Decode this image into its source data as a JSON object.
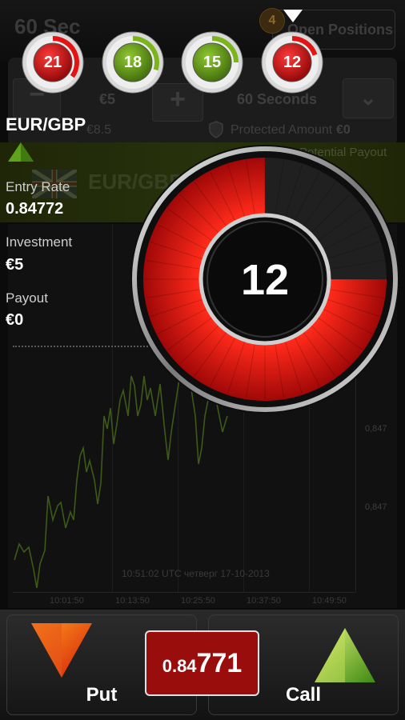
{
  "header": {
    "title": "60 Sec",
    "open_positions_label": "Open Positions",
    "open_positions_count": "4"
  },
  "trade_panel": {
    "investment_value": "€5",
    "expiry_value": "60 Seconds",
    "payout_value": "€8.5",
    "protected_amount_label": "Protected Amount",
    "protected_amount_value": "€0",
    "potential_payout_label": "Potential Payout"
  },
  "asset_bar": {
    "asset_name": "EUR/GBP"
  },
  "timers": [
    {
      "value": "21",
      "color": "red",
      "progress": 0.35
    },
    {
      "value": "18",
      "color": "green",
      "progress": 0.3
    },
    {
      "value": "15",
      "color": "green",
      "progress": 0.25
    },
    {
      "value": "12",
      "color": "red",
      "progress": 0.2
    }
  ],
  "big_timer": {
    "value": "12",
    "elapsed_fraction": 0.2
  },
  "position_info": {
    "asset": "EUR/GBP",
    "direction": "up",
    "entry_rate_label": "Entry Rate",
    "entry_rate_value": "0.84772",
    "investment_label": "Investment",
    "investment_value": "€5",
    "payout_label": "Payout",
    "payout_value": "€0"
  },
  "chart": {
    "timestamp": "10:51:02  UTC  четверг  17-10-2013",
    "x_ticks": [
      "10:01:50",
      "10:13:50",
      "10:25:50",
      "10:37:50",
      "10:49:50"
    ],
    "y_ticks": [
      "0,847",
      "0,847"
    ]
  },
  "bottom": {
    "put_label": "Put",
    "call_label": "Call",
    "price_prefix": "0.84",
    "price_main": "771"
  },
  "colors": {
    "red": "#e21414",
    "green": "#7cb41c",
    "price_box": "#9a0d0d"
  }
}
